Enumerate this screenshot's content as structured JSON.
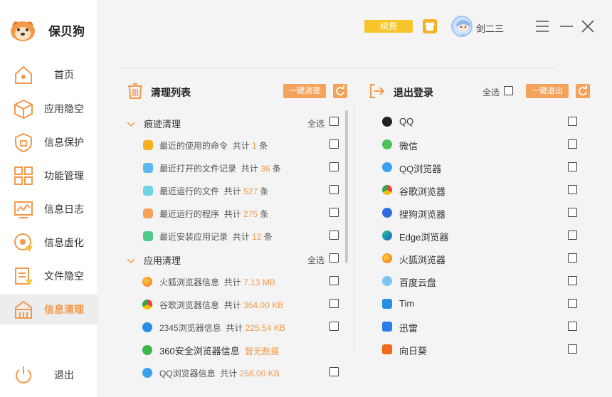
{
  "brand": {
    "name": "保贝狗"
  },
  "sidebar": {
    "items": [
      {
        "label": "首页"
      },
      {
        "label": "应用隐空"
      },
      {
        "label": "信息保护"
      },
      {
        "label": "功能管理"
      },
      {
        "label": "信息日志"
      },
      {
        "label": "信息虚化"
      },
      {
        "label": "文件隐空"
      },
      {
        "label": "信息清理"
      }
    ],
    "exit_label": "退出"
  },
  "topbar": {
    "renew_label": "续费",
    "username": "剑二三"
  },
  "clean_panel": {
    "title": "清理列表",
    "one_click_label": "一键清理",
    "sections": [
      {
        "label": "痕迹清理",
        "select_all": "全选"
      },
      {
        "label": "应用清理",
        "select_all": "全选"
      }
    ],
    "trace_rows": [
      {
        "name": "最近的使用的命令",
        "prefix": "共计",
        "count": "1",
        "unit": "条"
      },
      {
        "name": "最近打开的文件记录",
        "prefix": "共计",
        "count": "36",
        "unit": "条"
      },
      {
        "name": "最近运行的文件",
        "prefix": "共计",
        "count": "527",
        "unit": "条"
      },
      {
        "name": "最近运行的程序",
        "prefix": "共计",
        "count": "275",
        "unit": "条"
      },
      {
        "name": "最近安装应用记录",
        "prefix": "共计",
        "count": "12",
        "unit": "条"
      }
    ],
    "app_rows": [
      {
        "name": "火狐浏览器信息",
        "prefix": "共计",
        "size": "7.13 MB"
      },
      {
        "name": "谷歌浏览器信息",
        "prefix": "共计",
        "size": "364.00 KB"
      },
      {
        "name": "2345浏览器信息",
        "prefix": "共计",
        "size": "225.54 KB"
      },
      {
        "name": "360安全浏览器信息",
        "prefix": "",
        "size": "暂无数据"
      },
      {
        "name": "QQ浏览器信息",
        "prefix": "共计",
        "size": "256.00 KB"
      }
    ]
  },
  "logout_panel": {
    "title": "退出登录",
    "select_all": "全选",
    "one_click_label": "一键退出",
    "apps": [
      {
        "name": "QQ"
      },
      {
        "name": "微信"
      },
      {
        "name": "QQ浏览器"
      },
      {
        "name": "谷歌浏览器"
      },
      {
        "name": "搜狗浏览器"
      },
      {
        "name": "Edge浏览器"
      },
      {
        "name": "火狐浏览器"
      },
      {
        "name": "百度云盘"
      },
      {
        "name": "Tim"
      },
      {
        "name": "迅雷"
      },
      {
        "name": "向日葵"
      }
    ]
  }
}
